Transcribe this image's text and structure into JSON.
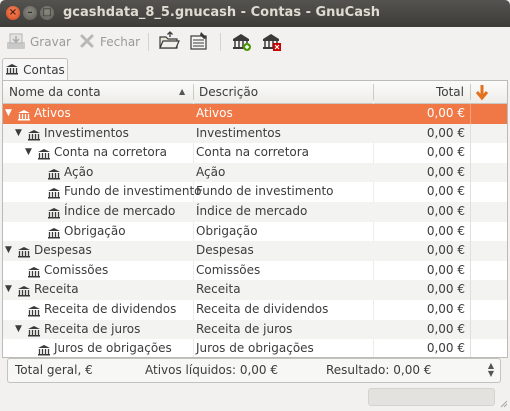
{
  "window": {
    "title": "gcashdata_8_5.gnucash - Contas - GnuCash"
  },
  "toolbar": {
    "save_label": "Gravar",
    "close_label": "Fechar"
  },
  "tabs": [
    {
      "label": "Contas"
    }
  ],
  "table": {
    "headers": {
      "name": "Nome da conta",
      "description": "Descrição",
      "total": "Total"
    },
    "rows": [
      {
        "name": "Ativos",
        "description": "Ativos",
        "total": "0,00 €",
        "expander": "▼",
        "selected": true
      },
      {
        "name": "Investimentos",
        "description": "Investimentos",
        "total": "0,00 €",
        "expander": "▼"
      },
      {
        "name": "Conta na corretora",
        "description": "Conta na corretora",
        "total": "0,00 €",
        "expander": "▼"
      },
      {
        "name": "Ação",
        "description": "Ação",
        "total": "0,00 €",
        "expander": ""
      },
      {
        "name": "Fundo de investimento",
        "description": "Fundo de investimento",
        "total": "0,00 €",
        "expander": ""
      },
      {
        "name": "Índice de mercado",
        "description": "Índice de mercado",
        "total": "0,00 €",
        "expander": ""
      },
      {
        "name": "Obrigação",
        "description": "Obrigação",
        "total": "0,00 €",
        "expander": ""
      },
      {
        "name": "Despesas",
        "description": "Despesas",
        "total": "0,00 €",
        "expander": "▼"
      },
      {
        "name": "Comissões",
        "description": "Comissões",
        "total": "0,00 €",
        "expander": ""
      },
      {
        "name": "Receita",
        "description": "Receita",
        "total": "0,00 €",
        "expander": "▼"
      },
      {
        "name": "Receita de dividendos",
        "description": "Receita de dividendos",
        "total": "0,00 €",
        "expander": ""
      },
      {
        "name": "Receita de juros",
        "description": "Receita de juros",
        "total": "0,00 €",
        "expander": "▼"
      },
      {
        "name": "Juros de obrigações",
        "description": "Juros de obrigações",
        "total": "0,00 €",
        "expander": ""
      }
    ]
  },
  "summary": {
    "total_label": "Total geral, €",
    "assets": "Ativos líquidos: 0,00 €",
    "result": "Resultado: 0,00 €"
  },
  "colors": {
    "accent": "#f07746",
    "titlebar": "#3d3c38"
  }
}
